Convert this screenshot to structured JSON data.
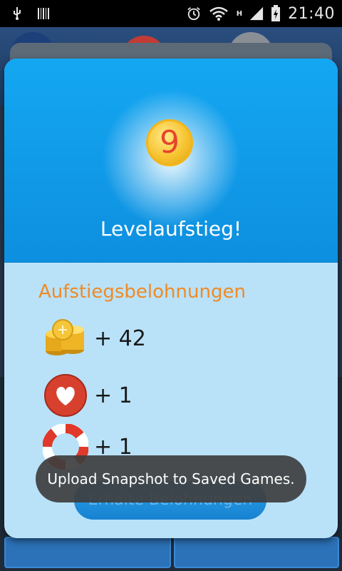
{
  "status_bar": {
    "time": "21:40",
    "network_type": "H",
    "left_icons": [
      "usb-icon",
      "barcode-icon"
    ],
    "right_icons": [
      "alarm-icon",
      "wifi-icon",
      "signal-icon",
      "battery-charging-icon"
    ]
  },
  "dialog": {
    "level_number": "9",
    "title": "Levelaufstieg!",
    "rewards_heading": "Aufstiegsbelohnungen",
    "rewards": [
      {
        "icon": "gold-coins-icon",
        "value": "+ 42"
      },
      {
        "icon": "heart-icon",
        "value": "+ 1"
      },
      {
        "icon": "lifebuoy-icon",
        "value": "+ 1"
      }
    ],
    "claim_button_label": "Erhalte Belohnungen"
  },
  "toast": {
    "message": "Upload Snapshot to Saved Games."
  },
  "colors": {
    "header_blue": "#0d8fdf",
    "body_light_blue": "#b9e2f9",
    "heading_orange": "#f08a24",
    "coin_number_red": "#e8442a"
  }
}
